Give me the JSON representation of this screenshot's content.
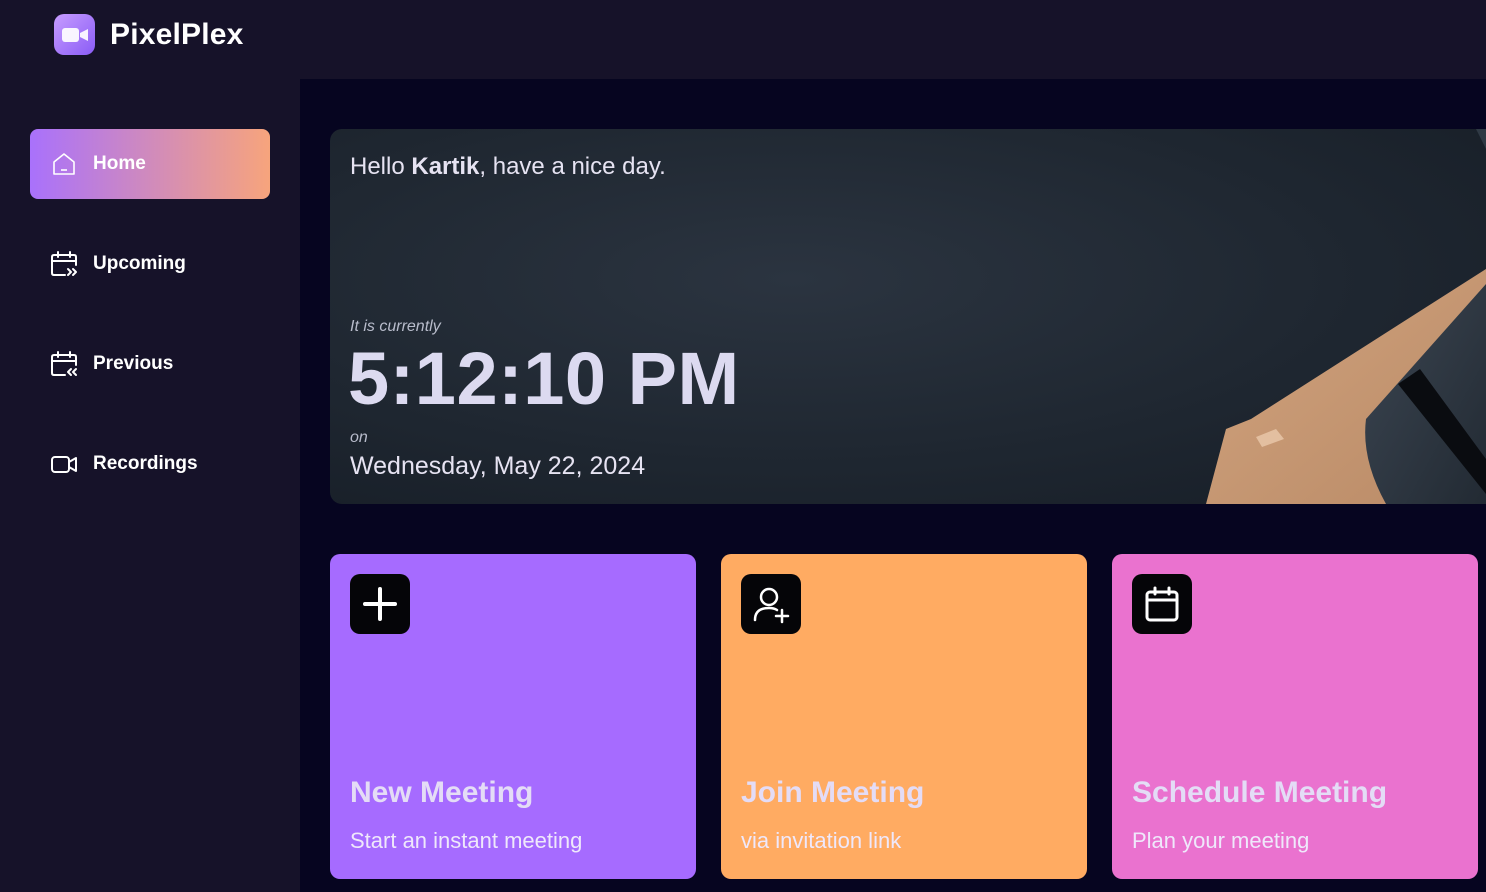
{
  "app": {
    "name": "PixelPlex",
    "logo_icon": "video-camera-icon"
  },
  "sidebar": {
    "items": [
      {
        "label": "Home",
        "icon": "home-icon",
        "active": true
      },
      {
        "label": "Upcoming",
        "icon": "calendar-forward-icon",
        "active": false
      },
      {
        "label": "Previous",
        "icon": "calendar-back-icon",
        "active": false
      },
      {
        "label": "Recordings",
        "icon": "video-icon",
        "active": false
      }
    ]
  },
  "hero": {
    "greeting_prefix": "Hello ",
    "user_name": "Kartik",
    "greeting_suffix": ", have a nice day.",
    "time_caption": "It is currently",
    "time": "5:12:10 PM",
    "date_caption": "on",
    "date": "Wednesday, May 22, 2024"
  },
  "cards": [
    {
      "title": "New Meeting",
      "subtitle": "Start an instant meeting",
      "icon": "plus-icon",
      "color": "#a66bff"
    },
    {
      "title": "Join Meeting",
      "subtitle": "via invitation link",
      "icon": "add-user-icon",
      "color": "#ffab62"
    },
    {
      "title": "Schedule Meeting",
      "subtitle": "Plan your meeting",
      "icon": "calendar-icon",
      "color": "#ea72cf"
    }
  ],
  "colors": {
    "background": "#161229",
    "main_background": "#060520",
    "active_gradient_start": "#a971fc",
    "active_gradient_end": "#f7a47c"
  }
}
